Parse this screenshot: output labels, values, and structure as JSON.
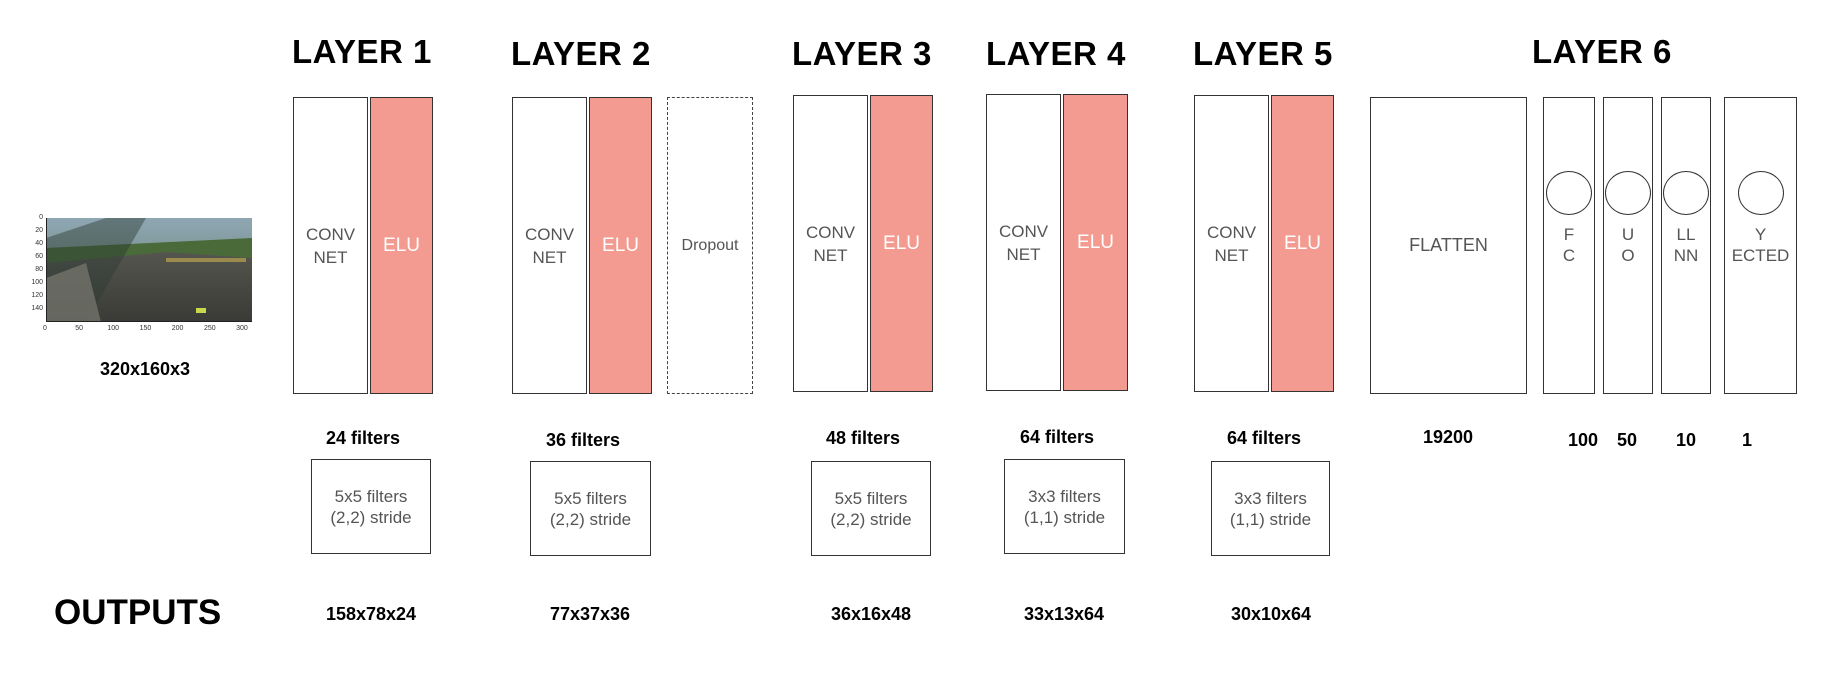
{
  "input": {
    "dimension_label": "320x160x3",
    "y_ticks": [
      "0",
      "20",
      "40",
      "60",
      "80",
      "100",
      "120",
      "140"
    ],
    "x_ticks": [
      "0",
      "50",
      "100",
      "150",
      "200",
      "250",
      "300"
    ]
  },
  "layers": [
    {
      "title": "LAYER 1",
      "conv": "CONV\nNET",
      "elu": "ELU",
      "filters": "24 filters",
      "kernel": "5x5 filters",
      "stride": "(2,2) stride",
      "output": "158x78x24"
    },
    {
      "title": "LAYER 2",
      "conv": "CONV\nNET",
      "elu": "ELU",
      "dropout": "Dropout",
      "filters": "36 filters",
      "kernel": "5x5 filters",
      "stride": "(2,2) stride",
      "output": "77x37x36"
    },
    {
      "title": "LAYER 3",
      "conv": "CONV\nNET",
      "elu": "ELU",
      "filters": "48 filters",
      "kernel": "5x5 filters",
      "stride": "(2,2) stride",
      "output": "36x16x48"
    },
    {
      "title": "LAYER 4",
      "conv": "CONV\nNET",
      "elu": "ELU",
      "filters": "64 filters",
      "kernel": "3x3 filters",
      "stride": "(1,1) stride",
      "output": "33x13x64"
    },
    {
      "title": "LAYER 5",
      "conv": "CONV\nNET",
      "elu": "ELU",
      "filters": "64 filters",
      "kernel": "3x3 filters",
      "stride": "(1,1) stride",
      "output": "30x10x64"
    }
  ],
  "layer6": {
    "title": "LAYER 6",
    "flatten": "FLATTEN",
    "flatten_size": "19200",
    "columns": [
      {
        "text_top": "F",
        "text_bottom": "C",
        "size": "100"
      },
      {
        "text_top": "U",
        "text_bottom": "O",
        "size": "50"
      },
      {
        "text_top": "LL",
        "text_bottom": "NN",
        "size": "10"
      },
      {
        "text_top": "Y",
        "text_bottom": "ECTED",
        "size": "1"
      }
    ]
  },
  "outputs_title": "OUTPUTS",
  "colors": {
    "elu": "#f39b90",
    "border": "#333333",
    "muted_text": "#555555"
  }
}
